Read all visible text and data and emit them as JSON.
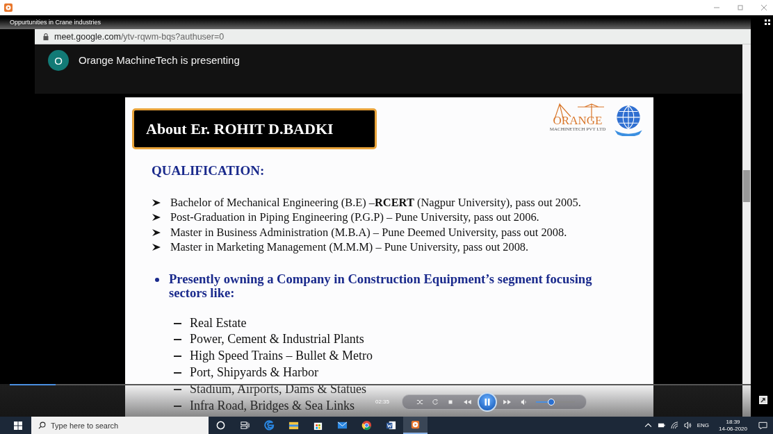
{
  "video": {
    "title": "Oppurtunities in Crane industries",
    "address_host": "meet.google.com",
    "address_path": "/ytv-rqwm-bqs?authuser=0",
    "presenter": {
      "initial": "O",
      "text": "Orange MachineTech is presenting"
    }
  },
  "slide": {
    "heading": "About Er. ROHIT D.BADKI",
    "logo_text": "ORANGE",
    "logo_subtext": "MACHINETECH PVT LTD",
    "section": "QUALIFICATION:",
    "qualifications": [
      "Bachelor of Mechanical Engineering (B.E) –**RCERT** (Nagpur University), pass out 2005.",
      "Post-Graduation in Piping Engineering (P.G.P) – Pune University, pass out 2006.",
      "Master in Business Administration (M.B.A) – Pune Deemed University, pass out 2008.",
      "Master in Marketing Management (M.M.M) – Pune University, pass out 2008."
    ],
    "bullet": "Presently owning a Company in Construction Equipment’s segment focusing sectors like:",
    "sectors": [
      "Real Estate",
      "Power, Cement & Industrial Plants",
      "High Speed Trains – Bullet & Metro",
      "Port, Shipyards & Harbor",
      "Stadium, Airports, Dams & Statues",
      "Infra Road, Bridges & Sea Links"
    ]
  },
  "playback": {
    "progress": {
      "level": 0.062
    },
    "time": "02:35",
    "playing": true,
    "volume": {
      "level": 0.4
    }
  },
  "taskbar": {
    "search_placeholder": "Type here to search",
    "apps": [
      {
        "kind": "cortana",
        "selected": false
      },
      {
        "kind": "taskview",
        "selected": false
      },
      {
        "kind": "edge",
        "selected": false
      },
      {
        "kind": "explorer",
        "selected": false
      },
      {
        "kind": "store",
        "selected": false
      },
      {
        "kind": "mail",
        "selected": false
      },
      {
        "kind": "chrome",
        "selected": false
      },
      {
        "kind": "word",
        "selected": false
      },
      {
        "kind": "player",
        "selected": true
      }
    ],
    "language": "ENG",
    "time": "18:39",
    "date": "14-06-2020"
  }
}
